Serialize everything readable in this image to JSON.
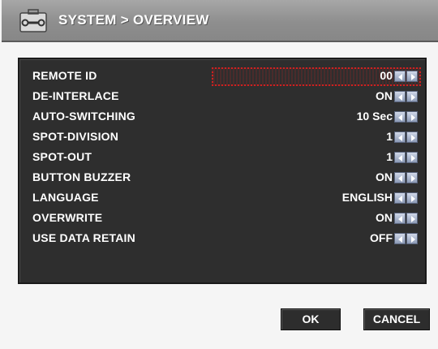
{
  "title": "SYSTEM > OVERVIEW",
  "settings": [
    {
      "label": "REMOTE ID",
      "value": "00",
      "selected": true
    },
    {
      "label": "DE-INTERLACE",
      "value": "ON"
    },
    {
      "label": "AUTO-SWITCHING",
      "value": "10 Sec"
    },
    {
      "label": "SPOT-DIVISION",
      "value": "1"
    },
    {
      "label": "SPOT-OUT",
      "value": "1"
    },
    {
      "label": "BUTTON BUZZER",
      "value": "ON"
    },
    {
      "label": "LANGUAGE",
      "value": "ENGLISH"
    },
    {
      "label": "OVERWRITE",
      "value": "ON"
    },
    {
      "label": "USE DATA RETAIN",
      "value": "OFF"
    }
  ],
  "buttons": {
    "ok": "OK",
    "cancel": "CANCEL"
  },
  "icons": {
    "title": "wrench-toolbox-icon",
    "decrement": "arrow-left-icon",
    "increment": "arrow-right-icon"
  },
  "colors": {
    "panel": "#2e2e2e",
    "selection": "#d02020",
    "titlebar": "#999999"
  }
}
